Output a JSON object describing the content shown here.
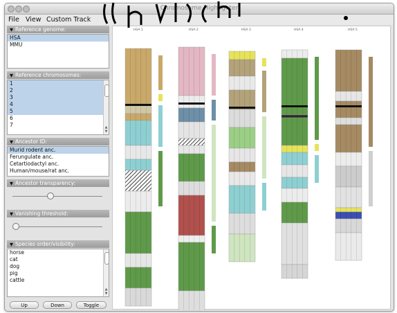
{
  "window": {
    "title": "Chromosome Highlighter"
  },
  "menu": {
    "file": "File",
    "view": "View",
    "custom_track": "Custom Track"
  },
  "sections": {
    "reference_genome": "Reference genome:",
    "reference_chromosomes": "Reference chromosomes:",
    "ancestor_id": "Ancestor ID:",
    "ancestor_transparency": "Ancestor transparency:",
    "vanishing_threshold": "Vanishing threshold:",
    "species_order": "Species order/visibility:"
  },
  "genomes": [
    {
      "label": "HSA",
      "selected": true
    },
    {
      "label": "MMU",
      "selected": false
    }
  ],
  "chromosomes": [
    {
      "label": "1",
      "selected": true
    },
    {
      "label": "2",
      "selected": true
    },
    {
      "label": "3",
      "selected": true
    },
    {
      "label": "4",
      "selected": true
    },
    {
      "label": "5",
      "selected": true
    },
    {
      "label": "6",
      "selected": false
    },
    {
      "label": "7",
      "selected": false
    }
  ],
  "ancestors": [
    {
      "label": "Murid rodent anc.",
      "selected": true
    },
    {
      "label": "Ferungulate anc.",
      "selected": false
    },
    {
      "label": "Cetartiodactyl anc.",
      "selected": false
    },
    {
      "label": "Human/mouse/rat anc.",
      "selected": false
    }
  ],
  "ancestor_transparency": 0.42,
  "vanishing_threshold": 0.0,
  "species": [
    "horse",
    "cat",
    "dog",
    "pig",
    "cattle"
  ],
  "buttons": {
    "up": "Up",
    "down": "Down",
    "toggle": "Toggle"
  },
  "chromosome_headers": [
    "HSA 1",
    "HSA 2",
    "HSA 3",
    "HSA 4",
    "HSA 5"
  ],
  "colors": {
    "selection": "#bcd3ea",
    "tan": "#c9a86a",
    "pink": "#e3b7c3",
    "olive": "#b3a27a",
    "green": "#5f9a4a",
    "teal": "#8ecfd2",
    "red": "#b0514e",
    "yellow": "#e6e35a",
    "blue": "#3b4fb0",
    "steel": "#6d8fa8",
    "brown": "#a58a63"
  }
}
